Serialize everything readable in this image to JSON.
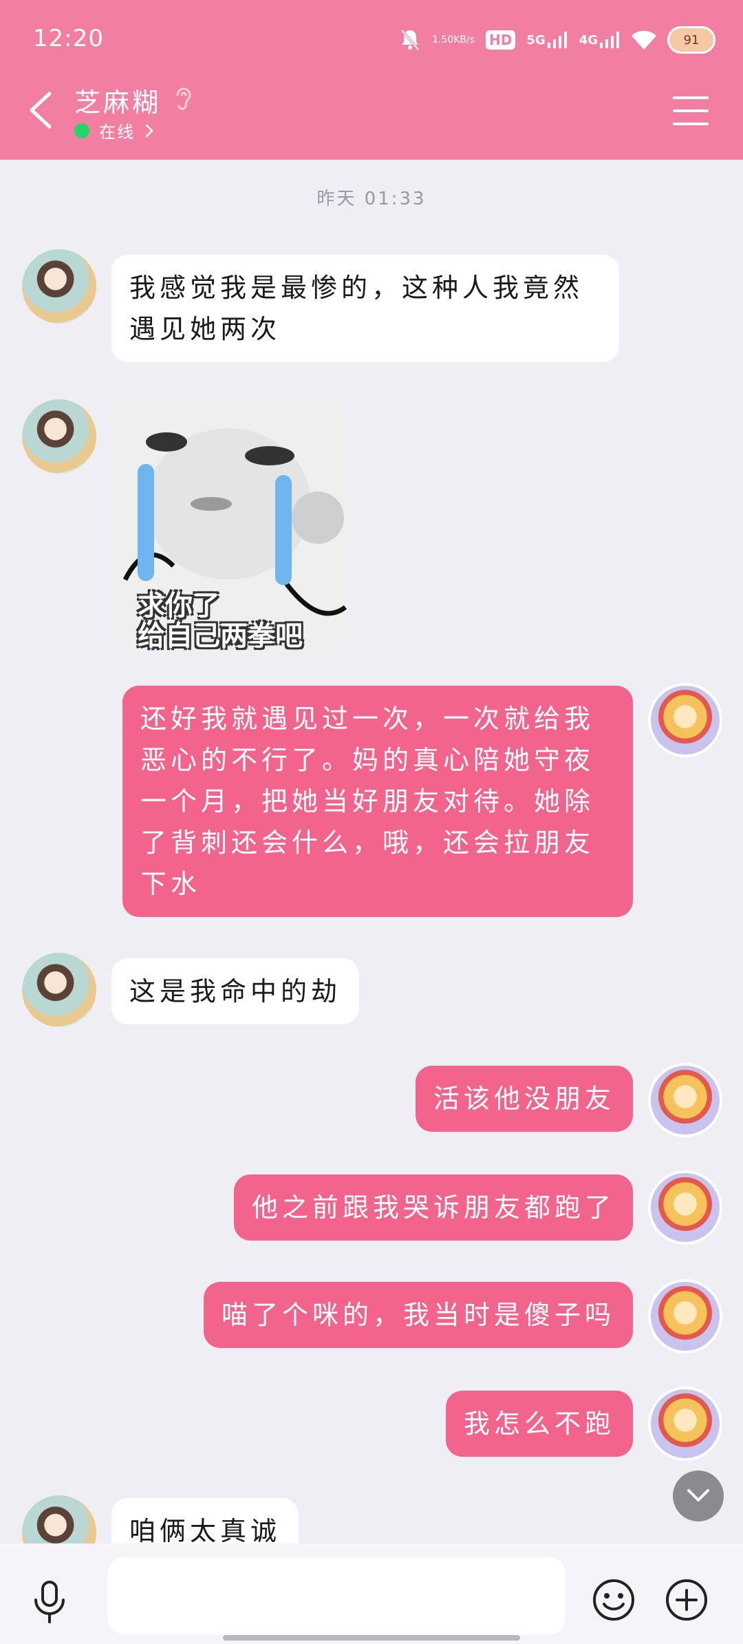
{
  "status_bar": {
    "time": "12:20",
    "speed_value": "1.50",
    "speed_unit": "KB/s",
    "hd_label": "HD",
    "net_5g": "5G",
    "net_4g": "4G",
    "battery": "91"
  },
  "header": {
    "contact_name": "芝麻糊",
    "status": "在线",
    "colors": {
      "bar": "#f27ea1",
      "online": "#26d46a"
    }
  },
  "chat": {
    "timestamp": "昨天 01:33",
    "messages": [
      {
        "side": "left",
        "type": "text",
        "lines": [
          "我感觉我是最惨的，这种人我竟然",
          "遇见她两次"
        ]
      },
      {
        "side": "left",
        "type": "sticker",
        "caption_lines": [
          "求你了",
          "给自己两拳吧"
        ]
      },
      {
        "side": "right",
        "type": "text",
        "lines": [
          "还好我就遇见过一次，一次就给我",
          "恶心的不行了。妈的真心陪她守夜",
          "一个月，把她当好朋友对待。她除",
          "了背刺还会什么，哦，还会拉朋友",
          "下水"
        ]
      },
      {
        "side": "left",
        "type": "text",
        "lines": [
          "这是我命中的劫"
        ]
      },
      {
        "side": "right",
        "type": "text",
        "lines": [
          "活该他没朋友"
        ]
      },
      {
        "side": "right",
        "type": "text",
        "lines": [
          "他之前跟我哭诉朋友都跑了"
        ]
      },
      {
        "side": "right",
        "type": "text",
        "lines": [
          "喵了个咪的，我当时是傻子吗"
        ]
      },
      {
        "side": "right",
        "type": "text",
        "lines": [
          "我怎么不跑"
        ]
      },
      {
        "side": "left",
        "type": "text",
        "lines": [
          "咱俩太真诚"
        ]
      }
    ],
    "colors": {
      "bubble_right": "#f2648c",
      "bubble_left": "#ffffff",
      "background": "#efeef4"
    }
  },
  "input_bar": {
    "placeholder": "",
    "icons": [
      "microphone-icon",
      "emoji-icon",
      "plus-icon"
    ]
  }
}
